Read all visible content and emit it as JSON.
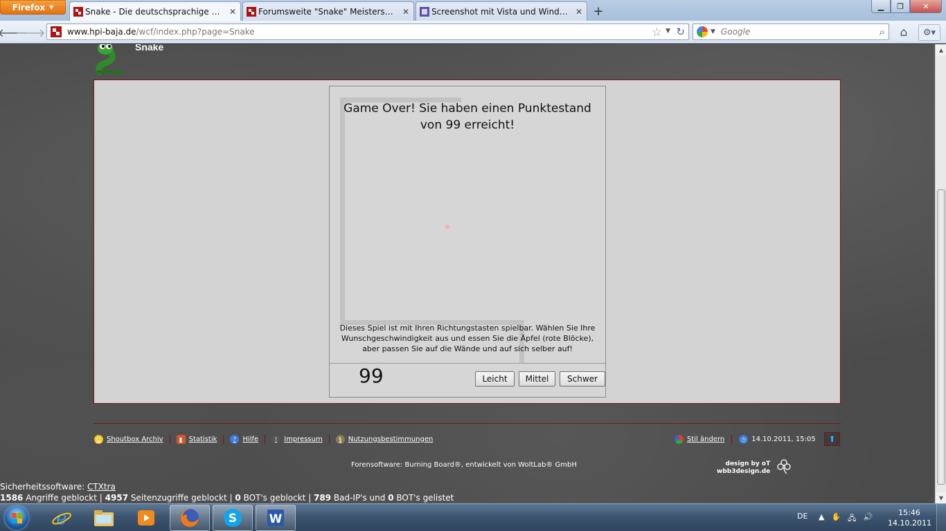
{
  "browser": {
    "app_button": "Firefox",
    "tabs": [
      {
        "label": "Snake - Die deutschsprachige HPI Baj..."
      },
      {
        "label": "Forumsweite \"Snake\" Meisterschaft!! ..."
      },
      {
        "label": "Screenshot mit Vista und Windows 7 ..."
      }
    ],
    "url_host": "www.hpi-baja.de",
    "url_path": "/wcf/index.php?page=Snake",
    "search_placeholder": "Google"
  },
  "page": {
    "title": "Snake",
    "game": {
      "game_over": "Game Over! Sie haben einen Punktestand von 99 erreicht!",
      "instructions": "Dieses Spiel ist mit Ihren Richtungstasten spielbar. Wählen Sie Ihre Wunschgeschwindigkeit aus und essen Sie die Äpfel (rote Blöcke), aber passen Sie auf die Wände und auf sich selber auf!",
      "score": "99",
      "buttons": {
        "easy": "Leicht",
        "medium": "Mittel",
        "hard": "Schwer"
      }
    },
    "footer": {
      "links": [
        "Shoutbox Archiv",
        "Statistik",
        "Hilfe",
        "Impressum",
        "Nutzungsbestimmungen"
      ],
      "style_link": "Stil ändern",
      "datetime": "14.10.2011, 15:05",
      "credits": "Forensoftware: Burning Board®, entwickelt von WoltLab® GmbH",
      "design_line1": "design by oT",
      "design_line2": "wbb3design.de"
    },
    "security": {
      "label": "Sicherheitssoftware:",
      "product": "CTXtra",
      "attacks": "1586",
      "attacks_label": "Angriffe geblockt |",
      "page_hits": "4957",
      "page_hits_label": "Seitenzugriffe geblockt |",
      "bots": "0",
      "bots_label": "BOT's geblockt |",
      "bad_ips": "789",
      "bad_ips_label": "Bad-IP's und",
      "bots_listed": "0",
      "bots_listed_label": "BOT's gelistet"
    }
  },
  "taskbar": {
    "language": "DE",
    "time": "15:46",
    "date": "14.10.2011"
  },
  "colors": {
    "accent_border": "#7a1515",
    "panel_bg": "#d3d3d3",
    "apple": "#f2b6b6"
  }
}
